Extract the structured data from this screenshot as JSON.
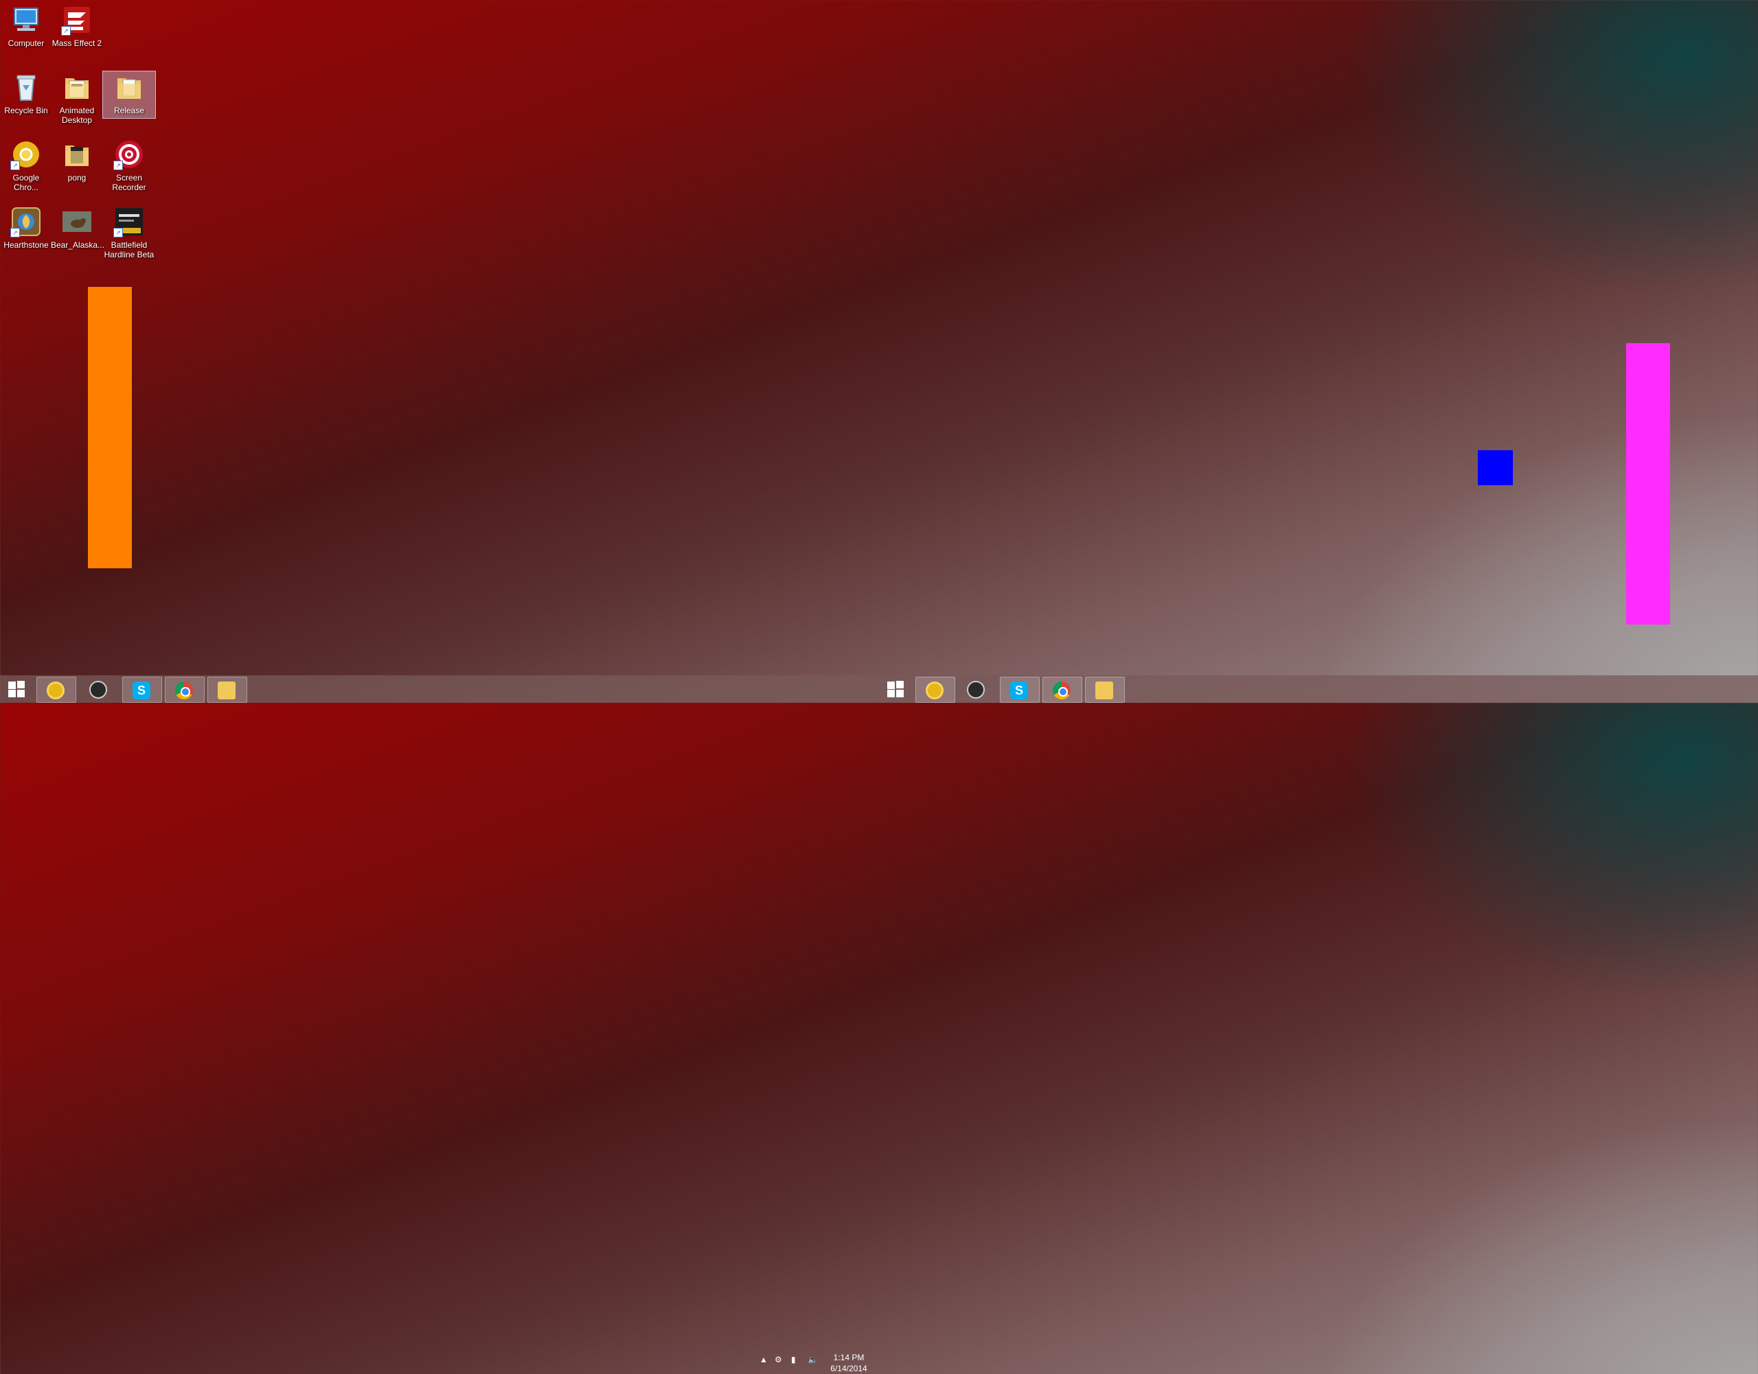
{
  "desktop": {
    "icons": [
      {
        "label": "Computer"
      },
      {
        "label": "Mass Effect 2"
      },
      {
        "label": "Recycle Bin"
      },
      {
        "label": "Animated Desktop"
      },
      {
        "label": "Release"
      },
      {
        "label": "Google Chro..."
      },
      {
        "label": "pong"
      },
      {
        "label": "Screen Recorder"
      },
      {
        "label": "Hearthstone"
      },
      {
        "label": "Bear_Alaska..."
      },
      {
        "label": "Battlefield Hardline Beta"
      }
    ]
  },
  "game": {
    "left_paddle_color": "#ff7f00",
    "right_paddle_color": "#ff2bff",
    "ball_color": "#0000ff"
  },
  "taskbar": {
    "clock_time": "1:14 PM",
    "clock_date": "6/14/2014",
    "tray_icons": [
      "show-hidden-icons",
      "steam-icon",
      "network-icon",
      "volume-icon"
    ],
    "left_apps": [
      "norton-icon",
      "steam-icon",
      "skype-icon",
      "chrome-icon",
      "file-explorer-icon"
    ],
    "right_apps": [
      "norton-icon",
      "steam-icon",
      "skype-icon",
      "chrome-icon",
      "file-explorer-icon"
    ]
  }
}
